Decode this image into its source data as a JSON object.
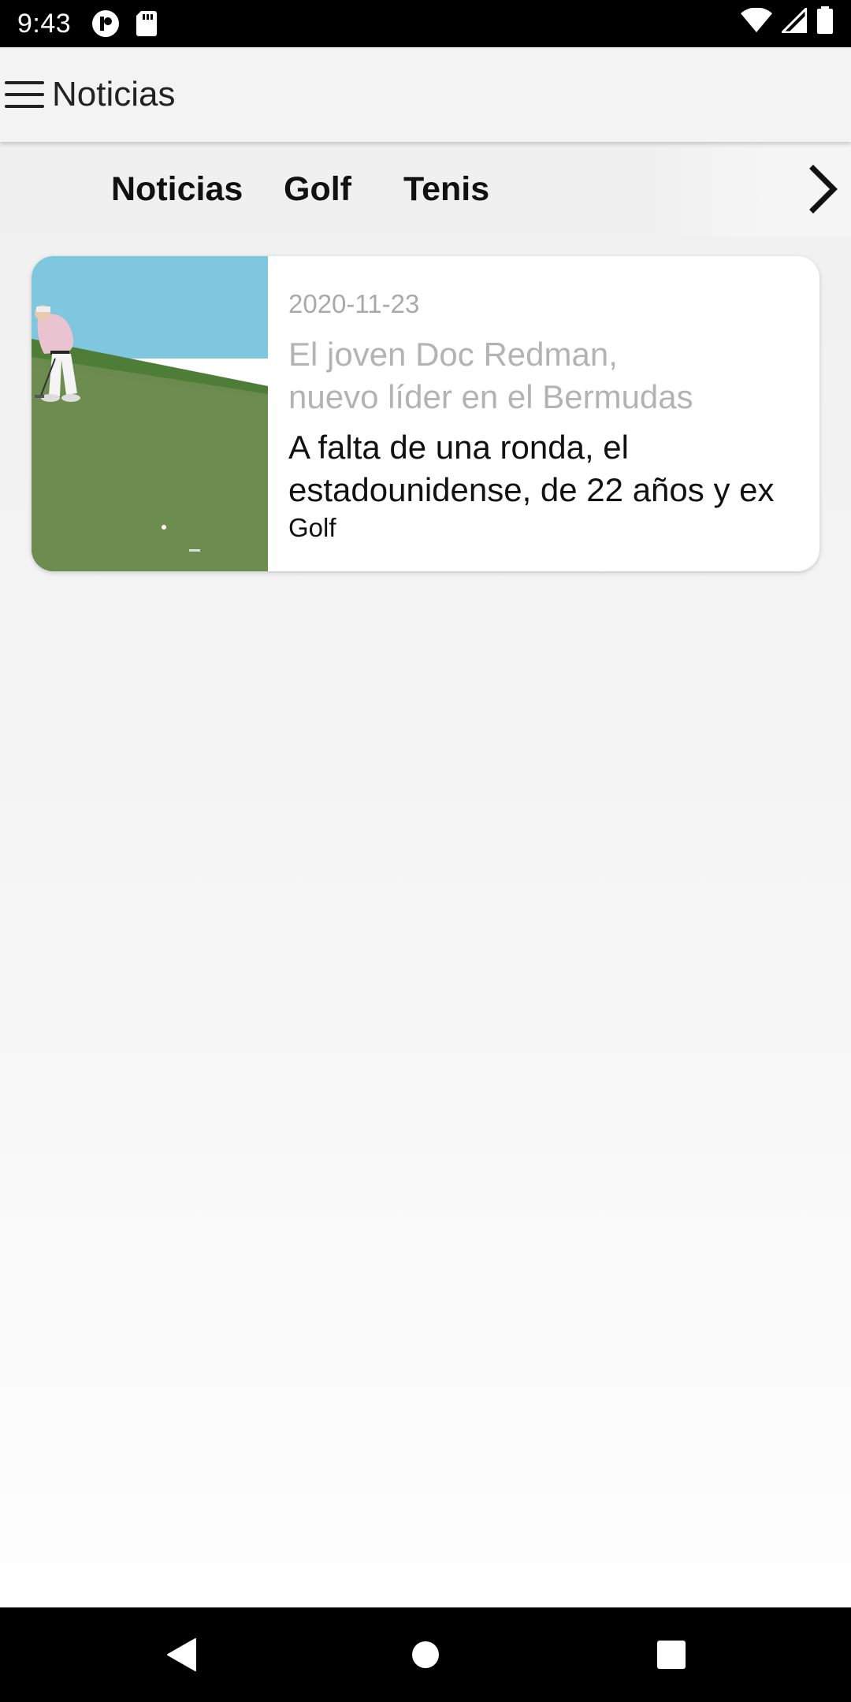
{
  "status_bar": {
    "time": "9:43"
  },
  "app_bar": {
    "title": "Noticias"
  },
  "tabs": [
    {
      "label": "Noticias"
    },
    {
      "label": "Golf"
    },
    {
      "label": "Tenis"
    }
  ],
  "articles": [
    {
      "date": "2020-11-23",
      "title_line1": "El joven Doc Redman,",
      "title_line2": "nuevo líder en el Bermudas",
      "summary_line1": "A falta de una ronda, el",
      "summary_line2": "estadounidense, de 22 años y ex",
      "category": "Golf",
      "image_icon": "golfer-putting-image"
    }
  ],
  "icons": {
    "menu": "menu-icon",
    "next": "chevron-right-icon",
    "back": "back-icon",
    "home": "home-icon",
    "recents": "recents-icon"
  },
  "colors": {
    "status_bar": "#000000",
    "app_bar": "#f3f3f3",
    "card_title_muted": "#b3b3b3",
    "date_muted": "#a9a9a9"
  }
}
